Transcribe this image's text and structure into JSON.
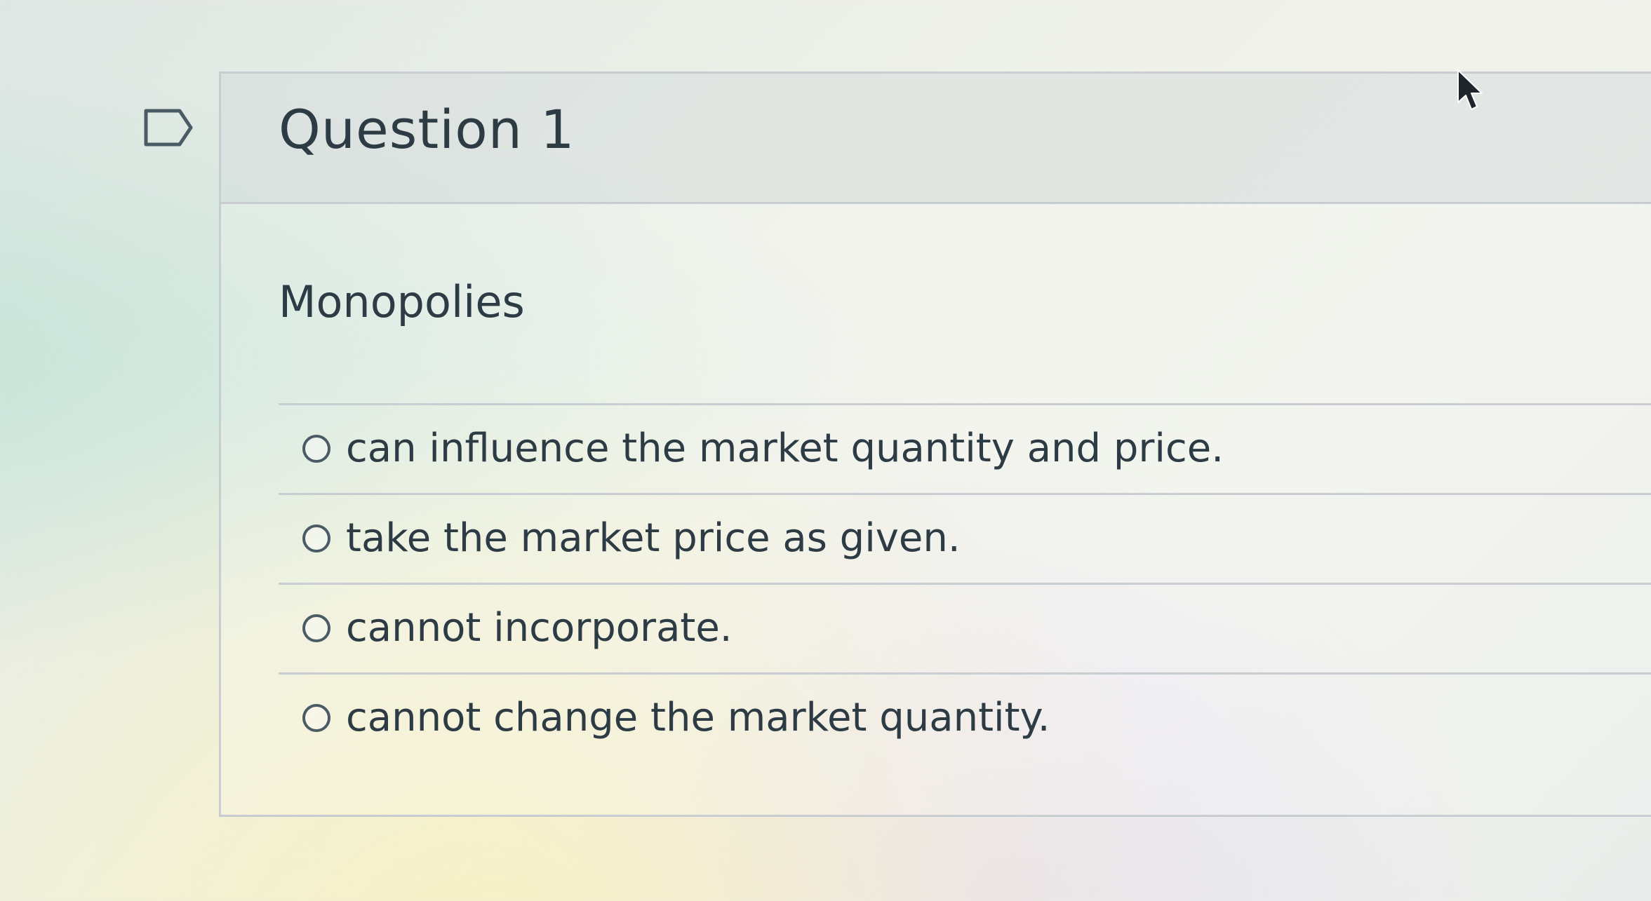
{
  "question": {
    "title": "Question 1",
    "text": "Monopolies",
    "flag_icon": "flag-outline-icon",
    "answers": [
      {
        "label": "can influence the market quantity and price.",
        "selected": false
      },
      {
        "label": "take the market price as given.",
        "selected": false
      },
      {
        "label": "cannot incorporate.",
        "selected": false
      },
      {
        "label": "cannot change the market quantity.",
        "selected": false
      }
    ]
  },
  "cursor_icon": "mouse-pointer-icon"
}
